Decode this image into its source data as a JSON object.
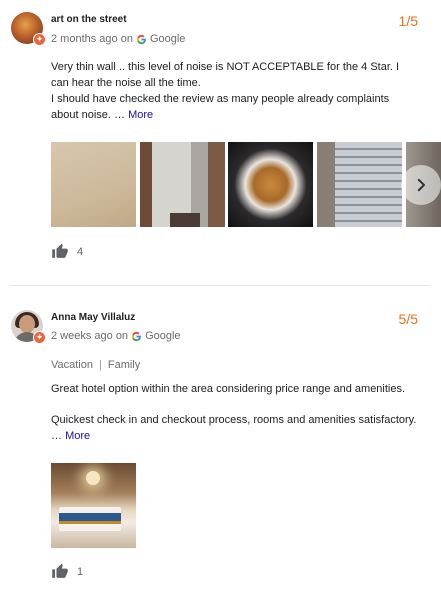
{
  "reviews": [
    {
      "name": "art on the street",
      "time": "2 months ago on",
      "source": "Google",
      "rating": "1/5",
      "text": "Very thin wall ..  this level of noise is NOT ACCEPTABLE for the 4 Star. I can hear the noise all the time.\nI should have checked the review as many people already complaints about noise. …",
      "more": "More",
      "likes": "4",
      "photos": [
        "photo-wall",
        "photo-window-view",
        "photo-food-plate",
        "photo-buildings",
        "photo-partial"
      ]
    },
    {
      "name": "Anna May Villaluz",
      "time": "2 weeks ago on",
      "source": "Google",
      "rating": "5/5",
      "trip_type": "Vacation",
      "travel_group": "Family",
      "text1": "Great hotel option within the area considering price range and amenities.",
      "text2": "Quickest check in and checkout process, rooms and amenities satisfactory. …",
      "more": "More",
      "likes": "1",
      "photos": [
        "photo-hotel-room"
      ]
    }
  ],
  "icons": {
    "badge": "local-guide-badge-icon",
    "source": "google-g-icon",
    "like": "thumbs-up-icon",
    "next": "chevron-right-icon"
  },
  "colors": {
    "rating": "#e8711a",
    "link": "#1a0dab",
    "badge": "#e8663d"
  }
}
